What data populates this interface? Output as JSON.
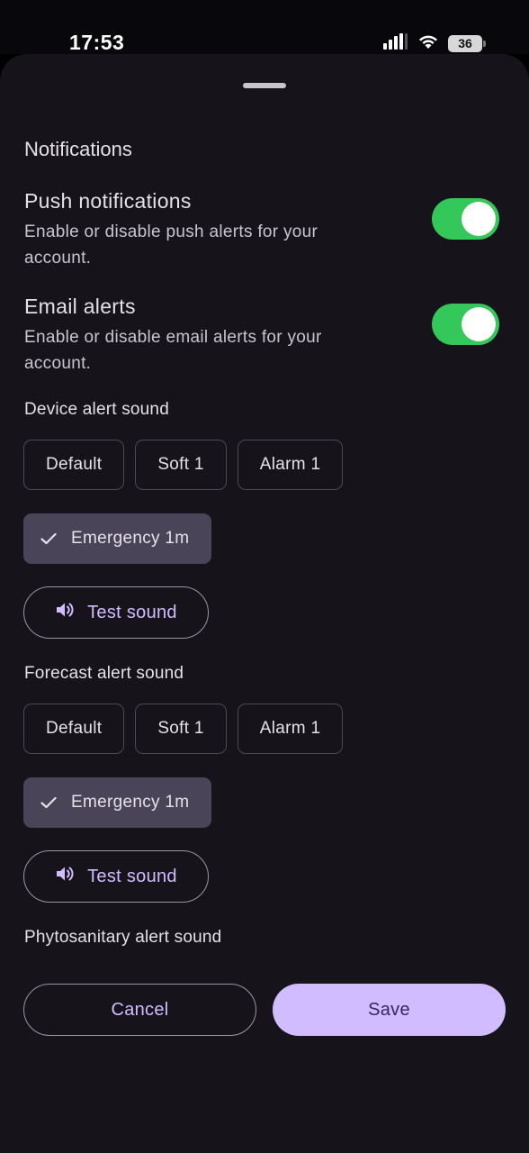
{
  "status_bar": {
    "time": "17:53",
    "battery_level": "36",
    "icons": [
      "signal-icon",
      "wifi-icon",
      "battery-icon"
    ]
  },
  "sheet": {
    "section_title": "Notifications",
    "push": {
      "title": "Push notifications",
      "description": "Enable or disable push alerts for your account.",
      "enabled": true
    },
    "email": {
      "title": "Email alerts",
      "description": "Enable or disable email alerts for your account.",
      "enabled": true
    },
    "device_sound": {
      "label": "Device alert sound",
      "options": [
        "Default",
        "Soft 1",
        "Alarm 1"
      ],
      "selected": "Emergency 1m",
      "test_label": "Test sound"
    },
    "forecast_sound": {
      "label": "Forecast alert sound",
      "options": [
        "Default",
        "Soft 1",
        "Alarm 1"
      ],
      "selected": "Emergency 1m",
      "test_label": "Test sound"
    },
    "phyto_sound": {
      "label": "Phytosanitary alert sound"
    },
    "actions": {
      "cancel": "Cancel",
      "save": "Save"
    }
  },
  "colors": {
    "sheet_bg": "#16141a",
    "toggle_on": "#34c759",
    "accent": "#d0bcff",
    "selected_chip": "#4a4458"
  }
}
